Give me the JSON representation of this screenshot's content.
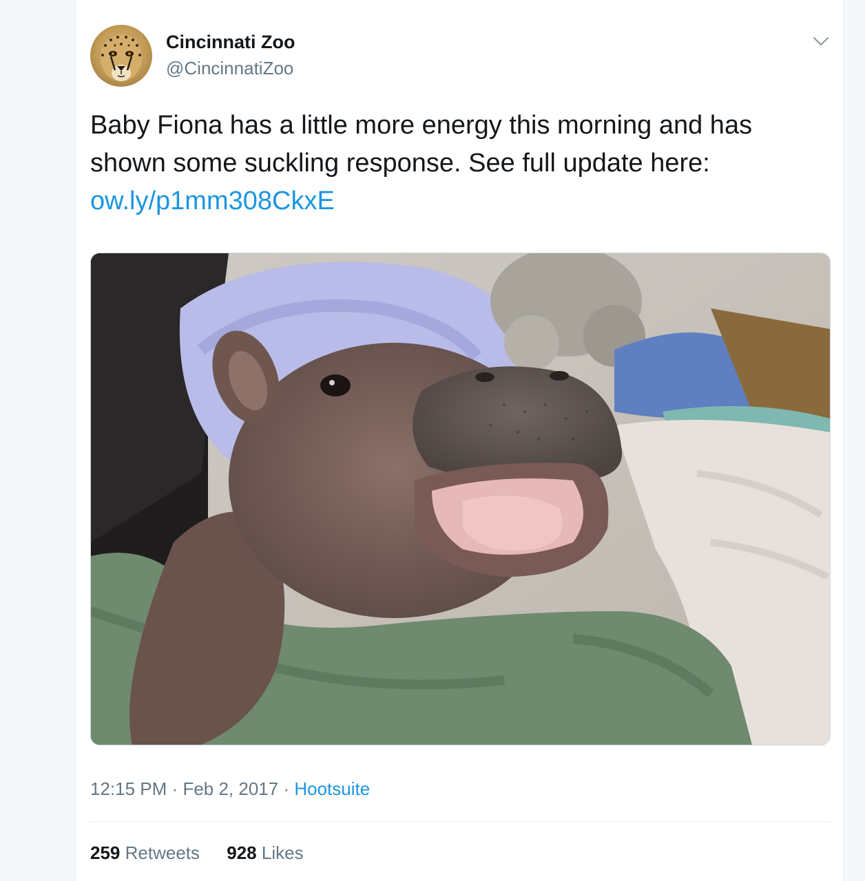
{
  "tweet": {
    "author": {
      "name": "Cincinnati Zoo",
      "handle": "@CincinnatiZoo",
      "avatar_icon": "cheetah-avatar"
    },
    "text": "Baby Fiona has a little more energy this morning and has shown some suckling response. See full update here:",
    "link": "ow.ly/p1mm308CkxE",
    "media": {
      "type": "photo",
      "icon": "baby-hippo-photo"
    },
    "meta": {
      "time": "12:15 PM",
      "separator": "·",
      "date": "Feb 2, 2017",
      "source": "Hootsuite"
    },
    "stats": {
      "retweets_count": "259",
      "retweets_label": "Retweets",
      "likes_count": "928",
      "likes_label": "Likes"
    }
  },
  "colors": {
    "link": "#1b95e0",
    "text": "#14171a",
    "secondary": "#657786",
    "border": "#e6ecf0"
  }
}
